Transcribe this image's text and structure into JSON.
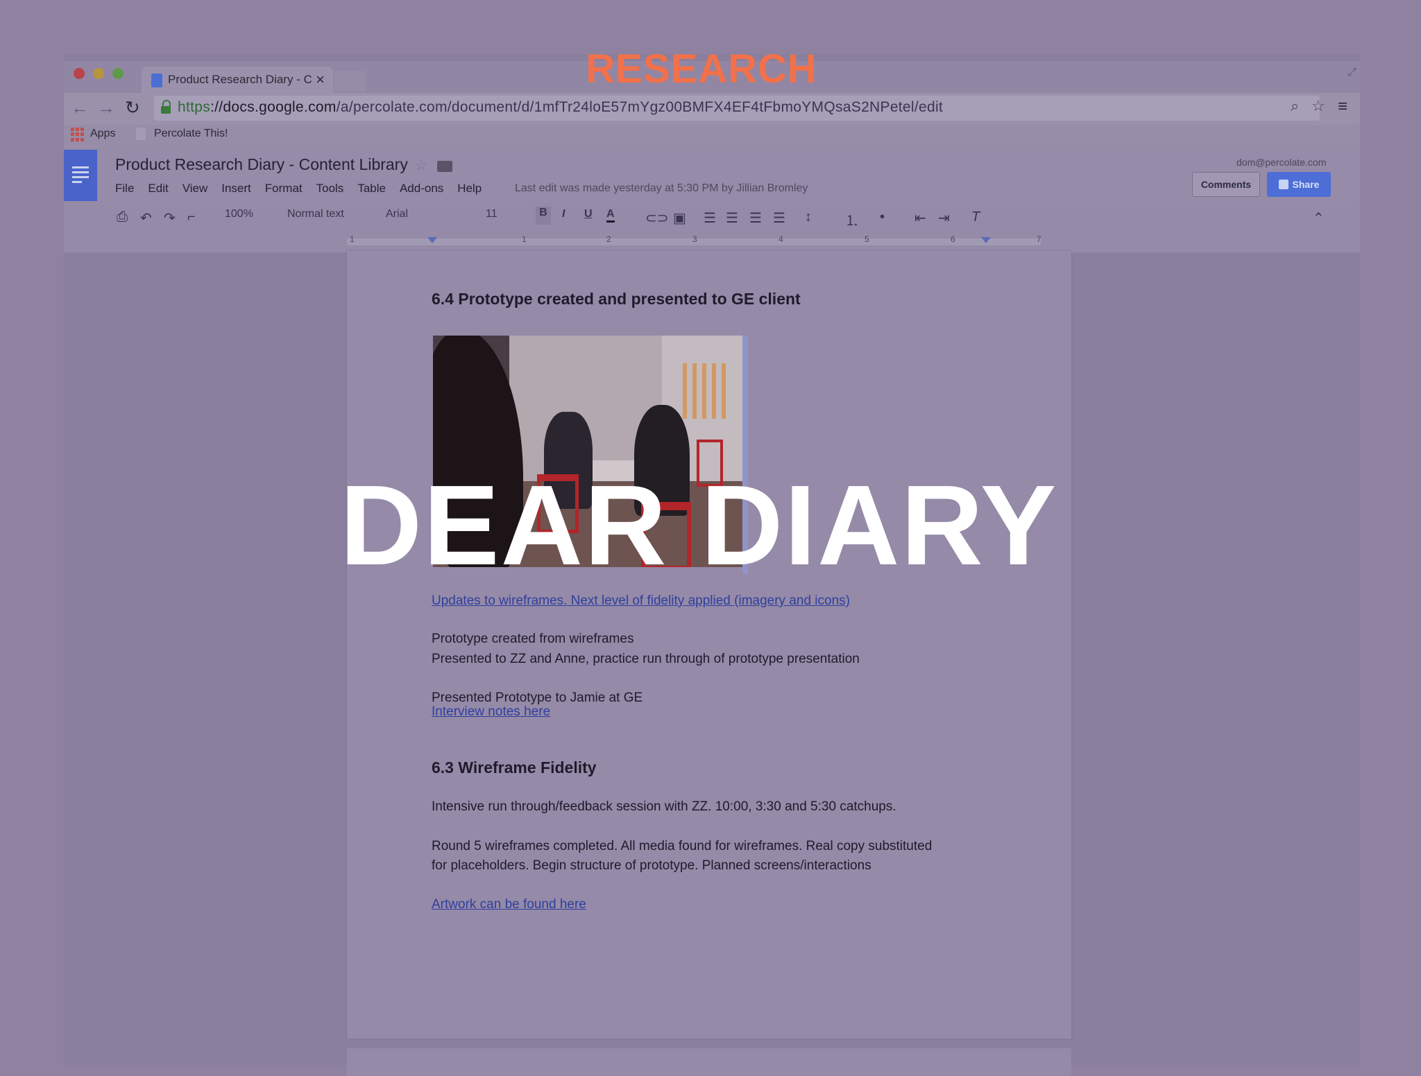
{
  "overlay": {
    "label": "RESEARCH",
    "headline": "DEAR DIARY"
  },
  "browser": {
    "tab_title": "Product Research Diary - C",
    "tab_close": "×",
    "url_scheme": "https",
    "url_host": "://docs.google.com",
    "url_path": "/a/percolate.com/document/d/1mfTr24loE57mYgz00BMFX4EF4tFbmoYMQsaS2NPetel/edit",
    "bookmarks": [
      {
        "label": "Apps"
      },
      {
        "label": "Percolate This!"
      }
    ]
  },
  "docs": {
    "title": "Product Research Diary - Content Library",
    "menu": [
      "File",
      "Edit",
      "View",
      "Insert",
      "Format",
      "Tools",
      "Table",
      "Add-ons",
      "Help"
    ],
    "last_edit": "Last edit was made yesterday at 5:30 PM by Jillian Bromley",
    "user_email": "dom@percolate.com",
    "comments_label": "Comments",
    "share_label": "Share",
    "toolbar": {
      "zoom": "100%",
      "style": "Normal text",
      "font": "Arial",
      "size": "11",
      "bold": "B",
      "italic": "I",
      "underline": "U",
      "text_color": "A"
    },
    "ruler_numbers": [
      "1",
      "1",
      "2",
      "3",
      "4",
      "5",
      "6",
      "7"
    ]
  },
  "document": {
    "section1_heading": "6.4 Prototype created and presented to GE client",
    "section1_link": "Updates to wireframes. Next level of fidelity applied (imagery and icons)",
    "section1_p1": "Prototype created from wireframes",
    "section1_p2": "Presented to ZZ and Anne, practice run through of prototype presentation",
    "section1_p3": "Presented Prototype to Jamie at GE",
    "section1_link2": "Interview notes here",
    "section2_heading": "6.3 Wireframe Fidelity",
    "section2_p1": "Intensive run through/feedback session with ZZ.  10:00, 3:30 and 5:30 catchups.",
    "section2_p2a": "Round 5 wireframes completed. All media found for wireframes. Real copy substituted",
    "section2_p2b": "for placeholders. Begin structure of prototype. Planned screens/interactions",
    "section2_link": "Artwork can be found here"
  },
  "colors": {
    "overlay_tint": "#8e82a0",
    "research_orange": "#f2714a",
    "headline_white": "#ffffff",
    "link_blue": "#2f3f9e",
    "share_blue": "#4d6ed6"
  }
}
